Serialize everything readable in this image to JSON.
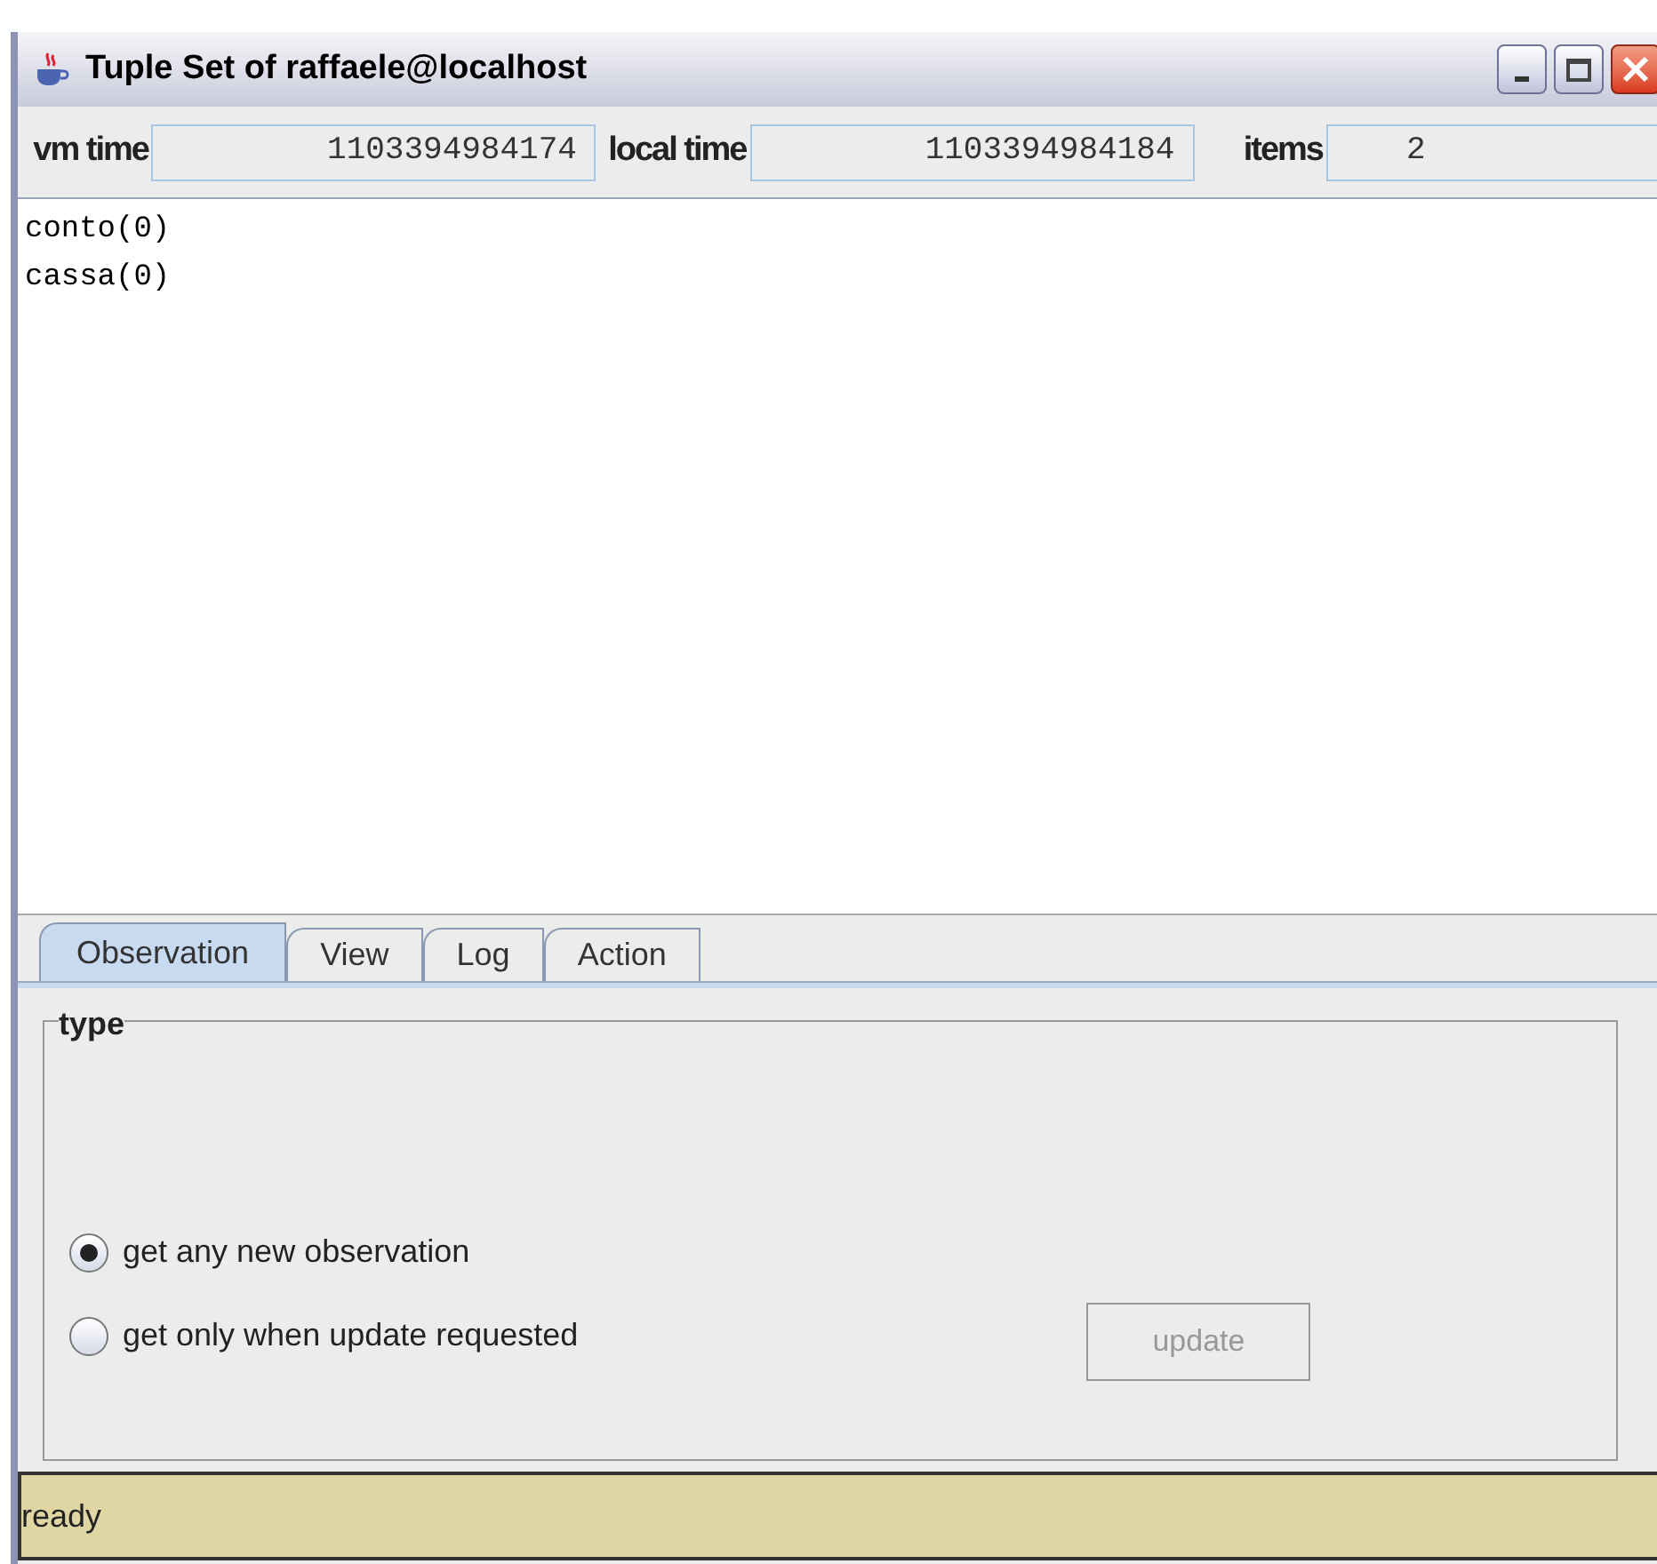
{
  "window": {
    "title": "Tuple Set of raffaele@localhost"
  },
  "header": [
    {
      "label": "vm time",
      "value": "1103394984174"
    },
    {
      "label": "local time",
      "value": "1103394984184"
    },
    {
      "label": "items",
      "value": "2"
    }
  ],
  "tuples": [
    "conto(0)",
    "cassa(0)"
  ],
  "tabs": [
    {
      "label": "Observation",
      "selected": true
    },
    {
      "label": "View",
      "selected": false
    },
    {
      "label": "Log",
      "selected": false
    },
    {
      "label": "Action",
      "selected": false
    }
  ],
  "group": {
    "title": "type"
  },
  "options": [
    {
      "label": "get any new observation",
      "selected": true
    },
    {
      "label": "get only when update requested",
      "selected": false
    }
  ],
  "update_button": {
    "label": "update",
    "disabled": true
  },
  "status_bar": "ready"
}
